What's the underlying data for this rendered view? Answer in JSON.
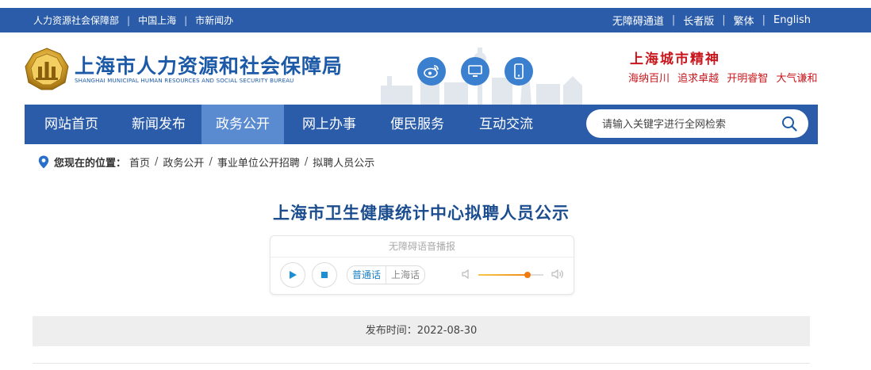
{
  "topbar": {
    "left_links": [
      "人力资源社会保障部",
      "中国上海",
      "市新闻办"
    ],
    "right_links": [
      "无障碍通道",
      "长者版",
      "繁体",
      "English"
    ]
  },
  "header": {
    "title_cn": "上海市人力资源和社会保障局",
    "title_en": "SHANGHAI MUNICIPAL HUMAN RESOURCES AND SOCIAL SECURITY BUREAU",
    "social_icons": [
      "weibo-icon",
      "desktop-icon",
      "mobile-icon"
    ],
    "spirit_title": "上海城市精神",
    "spirit_words": [
      "海纳百川",
      "追求卓越",
      "开明睿智",
      "大气谦和"
    ]
  },
  "nav": {
    "items": [
      "网站首页",
      "新闻发布",
      "政务公开",
      "网上办事",
      "便民服务",
      "互动交流"
    ],
    "active": "政务公开",
    "search_placeholder": "请输入关键字进行全网检索"
  },
  "breadcrumb": {
    "label": "您现在的位置：",
    "items": [
      "首页",
      "政务公开",
      "事业单位公开招聘",
      "拟聘人员公示"
    ]
  },
  "article": {
    "title": "上海市卫生健康统计中心拟聘人员公示",
    "publish_time": "发布时间：2022-08-30"
  },
  "player": {
    "title": "无障碍语音播报",
    "languages": [
      "普通话",
      "上海话"
    ],
    "selected_language": "普通话",
    "volume": 0.75
  },
  "colors": {
    "brand_blue": "#2a5caa",
    "nav_active": "#5a8ad0",
    "title_blue": "#1b4d8f",
    "spirit_red": "#c8161d"
  }
}
